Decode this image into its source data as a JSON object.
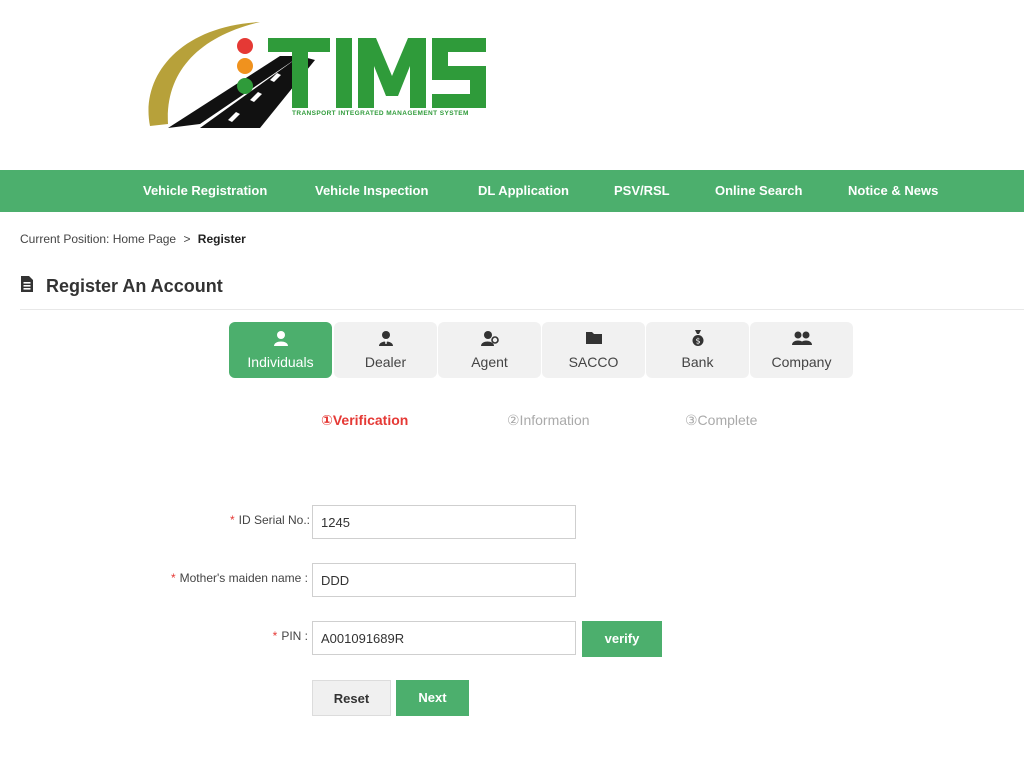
{
  "logo": {
    "name": "TIMS",
    "tagline": "TRANSPORT INTEGRATED MANAGEMENT SYSTEM"
  },
  "nav": {
    "items": [
      {
        "label": "Vehicle Registration"
      },
      {
        "label": "Vehicle Inspection"
      },
      {
        "label": "DL Application"
      },
      {
        "label": "PSV/RSL"
      },
      {
        "label": "Online Search"
      },
      {
        "label": "Notice & News"
      }
    ]
  },
  "breadcrumb": {
    "prefix": "Current Position:",
    "home": "Home Page",
    "separator": ">",
    "current": "Register"
  },
  "page": {
    "title": "Register An Account"
  },
  "account_types": [
    {
      "label": "Individuals",
      "icon": "user-icon",
      "active": true
    },
    {
      "label": "Dealer",
      "icon": "dealer-icon",
      "active": false
    },
    {
      "label": "Agent",
      "icon": "agent-icon",
      "active": false
    },
    {
      "label": "SACCO",
      "icon": "folder-icon",
      "active": false
    },
    {
      "label": "Bank",
      "icon": "money-bag-icon",
      "active": false
    },
    {
      "label": "Company",
      "icon": "group-icon",
      "active": false
    }
  ],
  "steps": [
    {
      "label": "①Verification",
      "active": true
    },
    {
      "label": "②Information",
      "active": false
    },
    {
      "label": "③Complete",
      "active": false
    }
  ],
  "form": {
    "required_mark": "*",
    "id_serial": {
      "label": "ID Serial No.:",
      "value": "1245"
    },
    "mothers_maiden_name": {
      "label": "Mother's maiden name :",
      "value": "DDD"
    },
    "pin": {
      "label": "PIN :",
      "value": "A001091689R"
    },
    "verify_label": "verify",
    "reset_label": "Reset",
    "next_label": "Next"
  },
  "colors": {
    "brand_green": "#4caf6d",
    "active_step": "#e53935",
    "logo_gold": "#b7a13a"
  }
}
